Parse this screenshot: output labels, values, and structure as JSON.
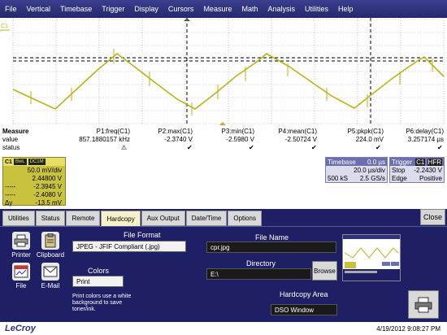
{
  "menu": [
    "File",
    "Vertical",
    "Timebase",
    "Trigger",
    "Display",
    "Cursors",
    "Measure",
    "Math",
    "Analysis",
    "Utilities",
    "Help"
  ],
  "channel_marker": "C1",
  "measure": {
    "headers": [
      "Measure",
      "P1:freq(C1)",
      "P2:max(C1)",
      "P3:min(C1)",
      "P4:mean(C1)",
      "P5:pkpk(C1)",
      "P6:delay(C1)"
    ],
    "value_label": "value",
    "status_label": "status",
    "values": [
      "857.1880157 kHz",
      "-2.3740 V",
      "-2.5980 V",
      "-2.50724 V",
      "224.0 mV",
      "3.257174 µs"
    ],
    "status_marks": [
      "⚠",
      "✔",
      "✔",
      "✔",
      "✔",
      "✔"
    ]
  },
  "c1": {
    "name": "C1",
    "tags": [
      "BwL",
      "DC1M"
    ],
    "lines": [
      {
        "label": "",
        "value": "50.0 mV/div"
      },
      {
        "label": "",
        "value": "2.44800 V"
      },
      {
        "label": "-----",
        "value": "-2.3945 V"
      },
      {
        "label": "-----",
        "value": "-2.4080 V"
      },
      {
        "label": "Δy",
        "value": "-13.5 mV"
      }
    ]
  },
  "timebase": {
    "title": "Timebase",
    "delay": "0.0 µs",
    "div": "20.0 µs/div",
    "samples": "500 kS",
    "rate": "2.5 GS/s"
  },
  "trigger": {
    "title": "Trigger",
    "tags": [
      "C1",
      "HFR"
    ],
    "mode": "Stop",
    "level": "-2.2430 V",
    "type": "Edge",
    "slope": "Positive"
  },
  "dialog": {
    "tabs": [
      "Utilities",
      "Status",
      "Remote",
      "Hardcopy",
      "Aux Output",
      "Date/Time",
      "Options"
    ],
    "active_tab": "Hardcopy",
    "close_label": "Close",
    "buttons": {
      "printer": "Printer",
      "clipboard": "Clipboard",
      "file": "File",
      "email": "E-Mail"
    },
    "file_format_label": "File Format",
    "file_format_value": "JPEG - JFIF Compliant (.jpg)",
    "colors_label": "Colors",
    "colors_value": "Print",
    "colors_note": "Print colors use a white background to save toner/ink.",
    "file_name_label": "File Name",
    "file_name_value": "cpr.jpg",
    "directory_label": "Directory",
    "directory_value": "E:\\",
    "browse_label": "Browse",
    "hardcopy_area_label": "Hardcopy Area",
    "hardcopy_area_value": "DSO Window"
  },
  "statusbar": {
    "brand": "LeCroy",
    "datetime": "4/19/2012 9:08:27 PM"
  },
  "colors": {
    "trace": "#b9b316",
    "menu": "#2e3280",
    "dialog": "#1f1f66",
    "c1_box": "#c9c23e"
  }
}
